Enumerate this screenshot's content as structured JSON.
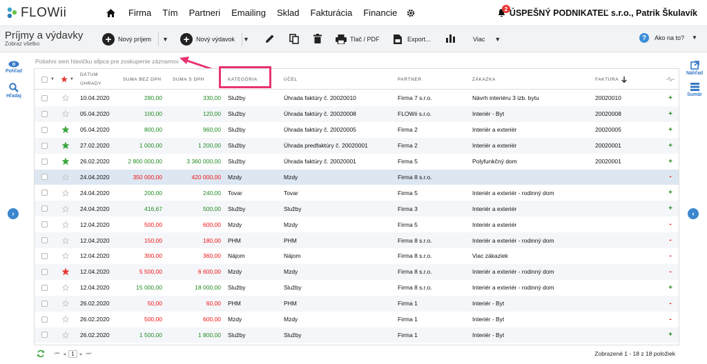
{
  "app": {
    "logo_text": "FLOWii"
  },
  "nav": {
    "items": [
      "Firma",
      "Tím",
      "Partneri",
      "Emailing",
      "Sklad",
      "Fakturácia",
      "Financie"
    ]
  },
  "header": {
    "notification_count": "2",
    "company": "ÚSPEŠNÝ PODNIKATEĽ s.r.o., Patrik Škulavík"
  },
  "page": {
    "title": "Príjmy a výdavky",
    "subtitle": "Zobraz všetko"
  },
  "toolbar": {
    "new_income": "Nový príjem",
    "new_expense": "Nový výdavok",
    "print_pdf": "Tlač / PDF",
    "export": "Export...",
    "more": "Viac",
    "help": "Ako na to?"
  },
  "left_sidebar": {
    "view_label": "Pohľad",
    "search_label": "Hľadaj"
  },
  "right_sidebar": {
    "preview_label": "Náhľad",
    "summary_label": "Sumár"
  },
  "grid": {
    "group_hint": "Potiahni sem hlavičku stĺpca pre zoskupenie záznamov",
    "columns": {
      "date_line1": "DÁTUM",
      "date_line2": "ÚHRADY",
      "sum_no_vat": "SUMA BEZ DPH",
      "sum_vat": "SUMA S DPH",
      "category": "KATEGÓRIA",
      "purpose": "ÚČEL",
      "partner": "PARTNER",
      "order": "ZÁKAZKA",
      "invoice": "FAKTÚRA"
    },
    "rows": [
      {
        "star": false,
        "date": "10.04.2020",
        "net": "280,00",
        "gross": "330,00",
        "type": "in",
        "category": "Služby",
        "purpose": "Úhrada faktúry č. 20020010",
        "partner": "Firma 7 s.r.o.",
        "order": "Návrh interiéru 3 izb. bytu",
        "invoice": "20020010",
        "pm": "+"
      },
      {
        "star": false,
        "date": "05.04.2020",
        "net": "100,00",
        "gross": "120,00",
        "type": "in",
        "category": "Služby",
        "purpose": "Úhrada faktúry č. 20020008",
        "partner": "FLOWii s.r.o.",
        "order": "Interiér - Byt",
        "invoice": "20020008",
        "pm": "+"
      },
      {
        "star": true,
        "date": "05.04.2020",
        "net": "800,00",
        "gross": "960,00",
        "type": "in",
        "category": "Služby",
        "purpose": "Úhrada faktúry č. 20020005",
        "partner": "Firma 2",
        "order": "Interiér a exteriér",
        "invoice": "20020005",
        "pm": "+"
      },
      {
        "star": true,
        "date": "27.02.2020",
        "net": "1 000,00",
        "gross": "1 200,00",
        "type": "in",
        "category": "Služby",
        "purpose": "Úhrada predfaktúry č. 20020001",
        "partner": "Firma 2",
        "order": "Interiér a exteriér",
        "invoice": "20020001",
        "pm": "+"
      },
      {
        "star": true,
        "date": "26.02.2020",
        "net": "2 800 000,00",
        "gross": "3 360 000,00",
        "type": "in",
        "category": "Služby",
        "purpose": "Úhrada faktúry č. 20020001",
        "partner": "Firma 5",
        "order": "Polyfunkčný dom",
        "invoice": "20020001",
        "pm": "+"
      },
      {
        "star": false,
        "date": "24.04.2020",
        "net": "350 000,00",
        "gross": "420 000,00",
        "type": "out",
        "category": "Mzdy",
        "purpose": "Mzdy",
        "partner": "Firma 8 s.r.o.",
        "order": "",
        "invoice": "",
        "pm": "-"
      },
      {
        "star": false,
        "date": "24.04.2020",
        "net": "200,00",
        "gross": "240,00",
        "type": "in",
        "category": "Tovar",
        "purpose": "Tovar",
        "partner": "Firma 5",
        "order": "Interiér a exteriér - rodinný dom",
        "invoice": "",
        "pm": "+"
      },
      {
        "star": false,
        "date": "24.04.2020",
        "net": "416,67",
        "gross": "500,00",
        "type": "in",
        "category": "Služby",
        "purpose": "Služby",
        "partner": "Firma 3",
        "order": "Interiér a exteriér",
        "invoice": "",
        "pm": "+"
      },
      {
        "star": false,
        "date": "12.04.2020",
        "net": "500,00",
        "gross": "600,00",
        "type": "out",
        "category": "Mzdy",
        "purpose": "Mzdy",
        "partner": "Firma 5",
        "order": "Interiér a exteriér",
        "invoice": "",
        "pm": "-"
      },
      {
        "star": false,
        "date": "12.04.2020",
        "net": "150,00",
        "gross": "180,00",
        "type": "out",
        "category": "PHM",
        "purpose": "PHM",
        "partner": "Firma 8 s.r.o.",
        "order": "Interiér a exteriér - rodinný dom",
        "invoice": "",
        "pm": "-"
      },
      {
        "star": false,
        "date": "12.04.2020",
        "net": "300,00",
        "gross": "360,00",
        "type": "out",
        "category": "Nájom",
        "purpose": "Nájom",
        "partner": "Firma 8 s.r.o.",
        "order": "Viac zákaziek",
        "invoice": "",
        "pm": "-"
      },
      {
        "star": true,
        "starColor": "red",
        "date": "12.04.2020",
        "net": "5 500,00",
        "gross": "6 600,00",
        "type": "out",
        "category": "Mzdy",
        "purpose": "Mzdy",
        "partner": "Firma 8 s.r.o.",
        "order": "Interiér a exteriér - rodinný dom",
        "invoice": "",
        "pm": "-"
      },
      {
        "star": false,
        "date": "12.04.2020",
        "net": "15 000,00",
        "gross": "18 000,00",
        "type": "in",
        "category": "Služby",
        "purpose": "Služby",
        "partner": "Firma 8 s.r.o.",
        "order": "Interiér a exteriér - rodinný dom",
        "invoice": "",
        "pm": "+"
      },
      {
        "star": false,
        "date": "26.02.2020",
        "net": "50,00",
        "gross": "60,00",
        "type": "out",
        "category": "PHM",
        "purpose": "PHM",
        "partner": "Firma 1",
        "order": "Interiér - Byt",
        "invoice": "",
        "pm": "-"
      },
      {
        "star": false,
        "date": "26.02.2020",
        "net": "500,00",
        "gross": "600,00",
        "type": "out",
        "category": "Mzdy",
        "purpose": "Mzdy",
        "partner": "Firma 1",
        "order": "Interiér - Byt",
        "invoice": "",
        "pm": "-"
      },
      {
        "star": false,
        "date": "26.02.2020",
        "net": "1 500,00",
        "gross": "1 800,00",
        "type": "in",
        "category": "Služby",
        "purpose": "Služby",
        "partner": "Firma 1",
        "order": "Interiér - Byt",
        "invoice": "",
        "pm": "+"
      }
    ]
  },
  "pager": {
    "current_page": "1",
    "status": "Zobrazené 1 - 18 z 18 položiek"
  },
  "colors": {
    "accent": "#3b86cf",
    "income": "#1f8a1f",
    "expense": "#ee1111",
    "highlight": "#e8336e",
    "selected_row": "#dde7f2"
  }
}
